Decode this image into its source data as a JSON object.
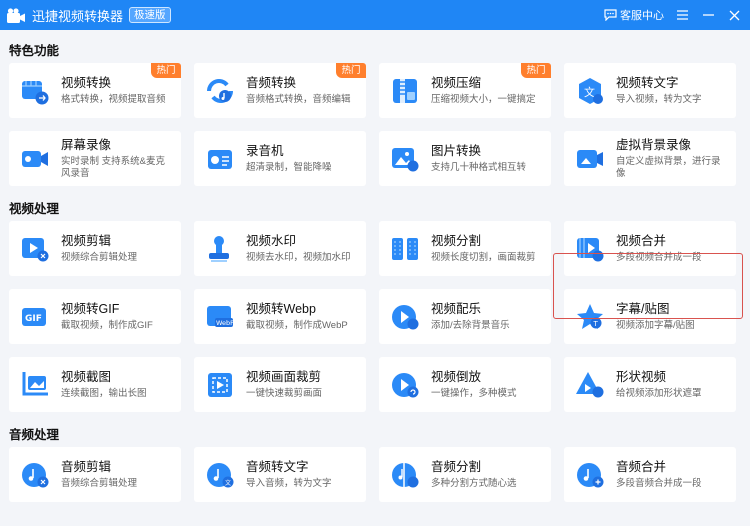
{
  "app": {
    "title": "迅捷视频转换器",
    "badge": "极速版"
  },
  "titlebar": {
    "service_label": "客服中心"
  },
  "sections": [
    {
      "title": "特色功能"
    },
    {
      "title": "视频处理"
    },
    {
      "title": "音频处理"
    }
  ],
  "cards": [
    {
      "title": "视频转换",
      "desc": "格式转换，视频提取音频",
      "hot": "热门",
      "icon": "video-convert-icon"
    },
    {
      "title": "音频转换",
      "desc": "音频格式转换，音频编辑",
      "hot": "热门",
      "icon": "audio-convert-icon"
    },
    {
      "title": "视频压缩",
      "desc": "压缩视频大小，一键搞定",
      "hot": "热门",
      "icon": "video-compress-icon"
    },
    {
      "title": "视频转文字",
      "desc": "导入视频，转为文字",
      "icon": "video-to-text-icon"
    },
    {
      "title": "屏幕录像",
      "desc": "实时录制 支持系统&麦克风录音",
      "icon": "screen-record-icon"
    },
    {
      "title": "录音机",
      "desc": "超清录制，智能降噪",
      "icon": "recorder-icon"
    },
    {
      "title": "图片转换",
      "desc": "支持几十种格式相互转",
      "icon": "image-convert-icon"
    },
    {
      "title": "虚拟背景录像",
      "desc": "自定义虚拟背景，进行录像",
      "icon": "virtual-bg-icon"
    },
    {
      "title": "视频剪辑",
      "desc": "视频综合剪辑处理",
      "icon": "video-edit-icon"
    },
    {
      "title": "视频水印",
      "desc": "视频去水印，视频加水印",
      "icon": "video-watermark-icon"
    },
    {
      "title": "视频分割",
      "desc": "视频长度切割，画面裁剪",
      "icon": "video-split-icon"
    },
    {
      "title": "视频合并",
      "desc": "多段视频合并成一段",
      "icon": "video-merge-icon"
    },
    {
      "title": "视频转GIF",
      "desc": "截取视频，制作成GIF",
      "icon": "video-to-gif-icon"
    },
    {
      "title": "视频转Webp",
      "desc": "截取视频，制作成WebP",
      "icon": "video-to-webp-icon"
    },
    {
      "title": "视频配乐",
      "desc": "添加/去除背景音乐",
      "icon": "video-music-icon"
    },
    {
      "title": "字幕/贴图",
      "desc": "视频添加字幕/贴图",
      "icon": "subtitle-sticker-icon"
    },
    {
      "title": "视频截图",
      "desc": "连续截图，输出长图",
      "icon": "video-screenshot-icon"
    },
    {
      "title": "视频画面裁剪",
      "desc": "一键快速裁剪画面",
      "icon": "video-crop-icon"
    },
    {
      "title": "视频倒放",
      "desc": "一键操作，多种模式",
      "icon": "video-reverse-icon"
    },
    {
      "title": "形状视频",
      "desc": "给视频添加形状遮罩",
      "icon": "shape-video-icon"
    },
    {
      "title": "音频剪辑",
      "desc": "音频综合剪辑处理",
      "icon": "audio-edit-icon"
    },
    {
      "title": "音频转文字",
      "desc": "导入音频，转为文字",
      "icon": "audio-to-text-icon"
    },
    {
      "title": "音频分割",
      "desc": "多种分割方式随心选",
      "icon": "audio-split-icon"
    },
    {
      "title": "音频合并",
      "desc": "多段音频合并成一段",
      "icon": "audio-merge-icon"
    }
  ],
  "colors": {
    "titlebar": "#1f86f5",
    "hot": "#ff7f2d",
    "highlight": "#d9534f",
    "icon_blue": "#2b8af7"
  }
}
